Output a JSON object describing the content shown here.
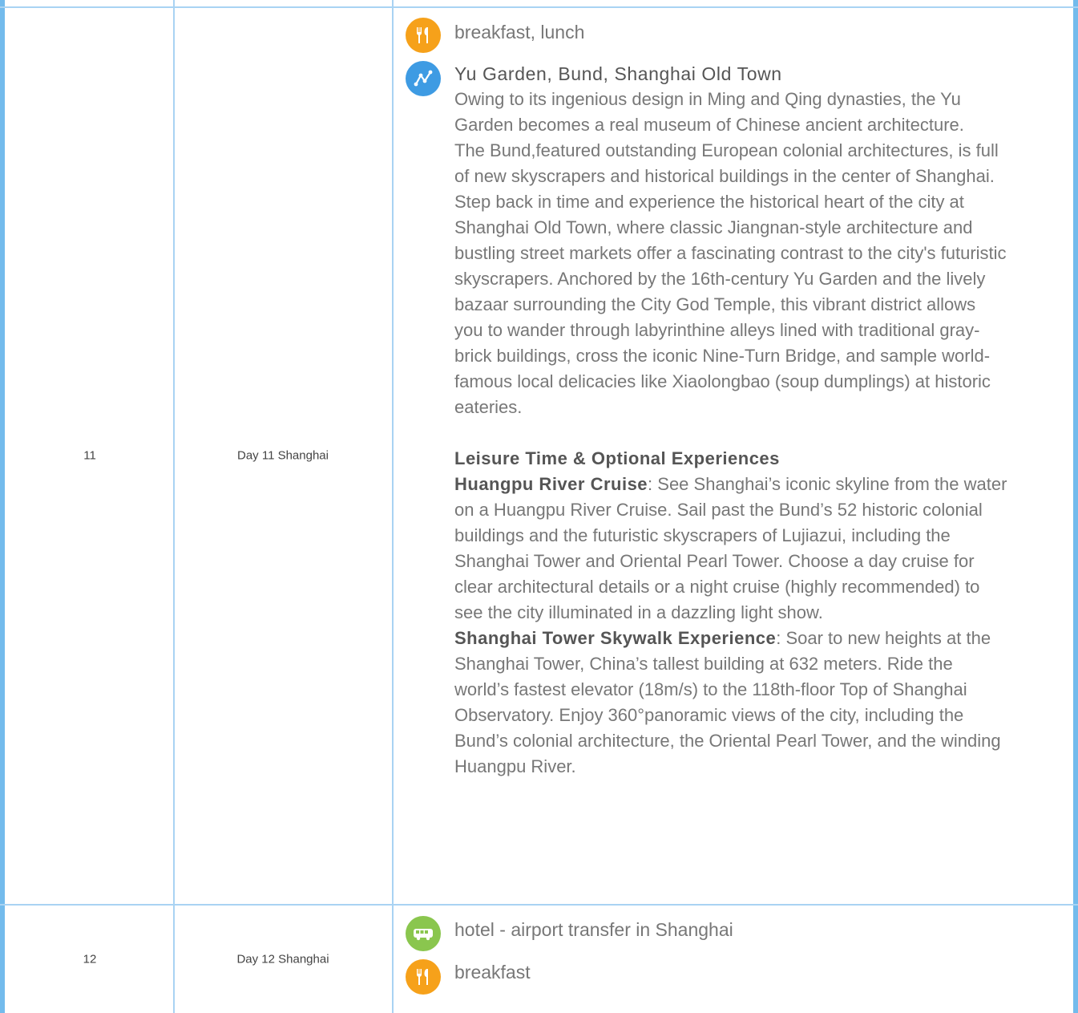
{
  "rows": [
    {
      "number": "11",
      "day": "Day 11 Shanghai",
      "meals": "breakfast, lunch",
      "route_title": "Yu Garden, Bund, Shanghai Old Town",
      "paragraphs": [
        "Owing to its ingenious design in Ming and Qing dynasties, the Yu Garden becomes a real museum of Chinese ancient architecture.",
        "The Bund,featured outstanding European colonial architectures, is full of new skyscrapers and historical buildings in the center of Shanghai.",
        "Step back in time and experience the historical heart of the city at Shanghai Old Town, where classic Jiangnan-style architecture and bustling street markets offer a fascinating contrast to the city's futuristic skyscrapers. Anchored by the 16th-century Yu Garden and the lively bazaar surrounding the City God Temple, this vibrant district allows you to wander through labyrinthine alleys lined with traditional gray-brick buildings, cross the iconic Nine-Turn Bridge, and sample world-famous local delicacies like Xiaolongbao (soup dumplings) at historic eateries."
      ],
      "leisure_heading": "Leisure Time & Optional Experiences",
      "options": [
        {
          "name": "Huangpu River Cruise",
          "text": ": See Shanghai’s iconic skyline from the water on a Huangpu River Cruise. Sail past the Bund’s 52 historic colonial buildings and the futuristic skyscrapers of Lujiazui, including the Shanghai Tower and Oriental Pearl Tower. Choose a day cruise for clear architectural details or a night cruise (highly recommended) to see the city illuminated in a dazzling light show."
        },
        {
          "name": "Shanghai Tower Skywalk Experience",
          "text": ": Soar to new heights at the Shanghai Tower, China’s tallest building at 632 meters. Ride the world’s fastest elevator (18m/s) to the 118th-floor Top of Shanghai Observatory. Enjoy 360°panoramic views of the city, including the Bund’s colonial architecture, the Oriental Pearl Tower, and the winding Huangpu River."
        }
      ]
    },
    {
      "number": "12",
      "day": "Day 12 Shanghai",
      "transfer": "hotel - airport transfer in Shanghai",
      "meals": "breakfast"
    }
  ],
  "icons": {
    "meal": "fork-knife-icon",
    "route": "route-icon",
    "transfer": "bus-icon"
  },
  "colors": {
    "border": "#a9d3f3",
    "meal_icon": "#f6a11a",
    "route_icon": "#3e9be3",
    "bus_icon": "#8ac64e"
  }
}
